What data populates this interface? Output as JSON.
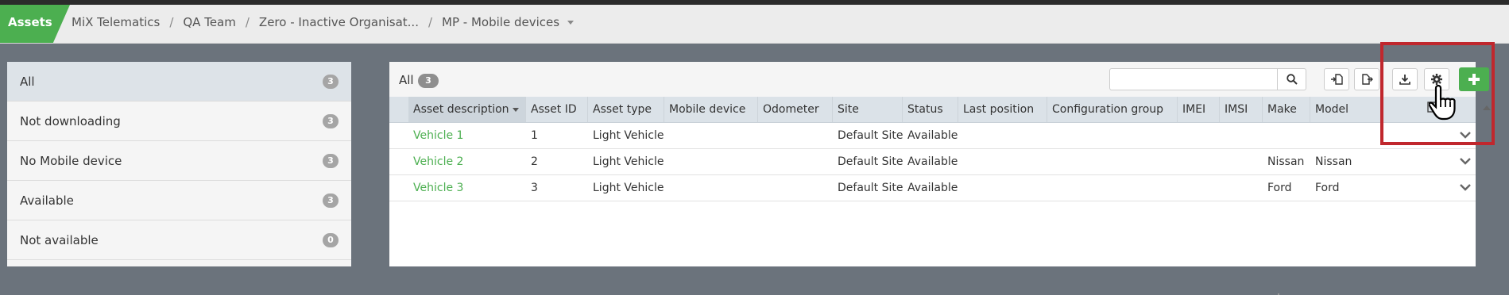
{
  "nav": {
    "app_tab": "Assets",
    "breadcrumb": [
      "MiX Telematics",
      "QA Team",
      "Zero - Inactive Organisat...",
      "MP - Mobile devices"
    ],
    "separator": "/"
  },
  "filters": [
    {
      "label": "All",
      "count": "3",
      "active": true
    },
    {
      "label": "Not downloading",
      "count": "3"
    },
    {
      "label": "No Mobile device",
      "count": "3"
    },
    {
      "label": "Available",
      "count": "3"
    },
    {
      "label": "Not available",
      "count": "0"
    }
  ],
  "main": {
    "title": "All",
    "count": "3",
    "search_placeholder": "",
    "toolbar_icons": [
      "import-icon",
      "export-icon",
      "download-icon",
      "gear-icon",
      "plus-icon"
    ]
  },
  "table": {
    "columns": [
      "Asset description",
      "Asset ID",
      "Asset type",
      "Mobile device",
      "Odometer",
      "Site",
      "Status",
      "Last position",
      "Configuration group",
      "IMEI",
      "IMSI",
      "Make",
      "Model"
    ],
    "rows": [
      {
        "description": "Vehicle 1",
        "id": "1",
        "type": "Light Vehicle",
        "mobile": "",
        "odometer": "",
        "site": "Default Site",
        "status": "Available",
        "last_position": "",
        "config": "",
        "imei": "",
        "imsi": "",
        "make": "",
        "model": ""
      },
      {
        "description": "Vehicle 2",
        "id": "2",
        "type": "Light Vehicle",
        "mobile": "",
        "odometer": "",
        "site": "Default Site",
        "status": "Available",
        "last_position": "",
        "config": "",
        "imei": "",
        "imsi": "",
        "make": "Nissan",
        "model": "Nissan"
      },
      {
        "description": "Vehicle 3",
        "id": "3",
        "type": "Light Vehicle",
        "mobile": "",
        "odometer": "",
        "site": "Default Site",
        "status": "Available",
        "last_position": "",
        "config": "",
        "imei": "",
        "imsi": "",
        "make": "Ford",
        "model": "Ford"
      }
    ]
  },
  "colors": {
    "accent": "#4caf50",
    "highlight": "#c0272d",
    "header_bg": "#dbe2e8"
  }
}
